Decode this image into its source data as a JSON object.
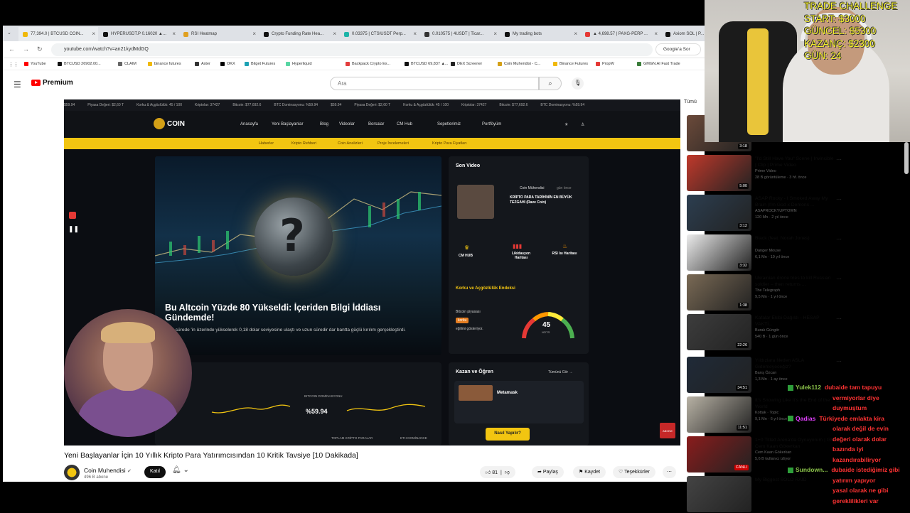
{
  "browser": {
    "tabs": [
      {
        "label": "77,394.0 | BTCUSD COIN..."
      },
      {
        "label": "HYPERUSDT.P 0.16020 ▲..."
      },
      {
        "label": "RSI Heatmap"
      },
      {
        "label": "Crypto Funding Rate Hea..."
      },
      {
        "label": "0.03375 | CTSIUSDT Perp..."
      },
      {
        "label": "0.010575 | 4USDT | Ticar..."
      },
      {
        "label": "My trading bots"
      },
      {
        "label": "▲ 4,698.57 | PAXG-PERP ..."
      },
      {
        "label": "Axiom SOL | P..."
      }
    ],
    "url": "youtube.com/watch?v=an21kydMdGQ",
    "google_label": "Google'a Sor",
    "bookmarks": [
      {
        "label": "YouTube",
        "color": "#ff0000"
      },
      {
        "label": "BTCUSD 26902.00...",
        "color": "#111111"
      },
      {
        "label": "CLAIM",
        "color": "#666666"
      },
      {
        "label": "binance futures",
        "color": "#f0b90b"
      },
      {
        "label": "Aster",
        "color": "#333333"
      },
      {
        "label": "OKX",
        "color": "#000000"
      },
      {
        "label": "Bitget Futures",
        "color": "#1da2b4"
      },
      {
        "label": "Hyperliquid",
        "color": "#59d6a4"
      },
      {
        "label": "Backpack Crypto Ex...",
        "color": "#e33d3d"
      },
      {
        "label": "BTCUSD 69,837 ▲...",
        "color": "#111111"
      },
      {
        "label": "DEX Screener",
        "color": "#222222"
      },
      {
        "label": "Coin Muhendisi - C...",
        "color": "#d4a017"
      },
      {
        "label": "Binance Futures",
        "color": "#f0b90b"
      },
      {
        "label": "PropW",
        "color": "#e53935"
      },
      {
        "label": "GMGN.AI Fast Trade",
        "color": "#3a7d3a"
      }
    ]
  },
  "youtube": {
    "logo_text": "Premium",
    "search_placeholder": "Ara",
    "video": {
      "title": "Yeni Başlayanlar İçin 10 Yıllık Kripto Para Yatırımcısından 10 Kritik Tavsiye [10 Dakikada]",
      "channel": "Coin Muhendisi",
      "subscribers": "496 B abone",
      "join_label": "Katıl",
      "likes": "81",
      "share_label": "Paylaş",
      "save_label": "Kaydet",
      "thanks_label": "Teşekkürler"
    },
    "sidebar_tab": "Tümü",
    "recommendations": [
      {
        "title": "",
        "channel": "",
        "meta": "1,1 Mn · 14 yıl önce",
        "duration": "3:18",
        "color": "#6b4a3a"
      },
      {
        "title": "\"I'd Still Have You\" Scene | Invincible | Clip | Prime Video",
        "channel": "Prime Video",
        "meta": "28 B görüntüleme · 3 hf. önce",
        "duration": "5:00",
        "color": "#c0392b"
      },
      {
        "title": "ASAP Rocky - I Smoked Away My Brain (I'm God x Demons ...",
        "channel": "ASAPROCKYUPTOWN",
        "meta": "120 Mn · 2 yıl önce",
        "duration": "3:12",
        "color": "#2c3e50"
      },
      {
        "title": "Black (feat. Norah Jones)",
        "channel": "Danger Mouse",
        "meta": "6,1 Mn · 10 yıl önce",
        "duration": "3:32",
        "color": "#ececec"
      },
      {
        "title": "Ukrainian drone tries to kill Russian soldier – then returns ...",
        "channel": "The Telegraph",
        "meta": "9,5 Mn · 1 yıl önce",
        "duration": "1:38",
        "color": "#7a6a55"
      },
      {
        "title": "Kafalar Ekibi Dağıldı - HESAP VAKTİ...",
        "channel": "Burak Güngör",
        "meta": "540 B · 1 gün önce",
        "duration": "22:26",
        "color": "#3d3d3d"
      },
      {
        "title": "Yıldızlara Neden ASLA Gidemeyeceğiz?",
        "channel": "Barış Özcan",
        "meta": "1,3 Mn · 1 ay önce",
        "duration": "34:51",
        "color": "#1f2a38"
      },
      {
        "title": "It's Snowing Like It's the End of the World",
        "channel": "Kottak · Topic",
        "meta": "9,1 Mn · 6 yıl önce",
        "duration": "11:51",
        "color": "#b8b2a5"
      },
      {
        "title": "1+0 Titled Arena'da Oynuyorum | GM Cem Kaan Gökerkan",
        "channel": "Cem Kaan Gökerkan",
        "meta": "5,6 B kullanıcı izliyor",
        "duration": "CANLI",
        "color": "#8a1c1c"
      },
      {
        "title": "My Biggest SOLO RAID",
        "channel": "",
        "meta": "",
        "duration": "",
        "color": "#444444"
      }
    ]
  },
  "embedded_site": {
    "brand": "COIN",
    "nav": [
      "Anasayfa",
      "Yeni Başlayanlar",
      "Blog",
      "Videolar",
      "Borsalar",
      "CM Hub",
      "Sepetlerimiz",
      "Portföyüm"
    ],
    "subnav": [
      "Haberler",
      "Kripto Rehberi",
      "Coin Analizleri",
      "Proje İncelemeleri",
      "Kripto Para Fiyatları"
    ],
    "ticker": [
      "$59.94",
      "Piyasa Değeri: $2,60 T",
      "Korku & Açgözlülük: 45 / 100",
      "Kriptolar: 37427",
      "Bitcoin: $77,692.6",
      "BTC Dominasyonu: %59.94"
    ],
    "headline": "Bu Altcoin Yüzde 80 Yükseldi: İçeriden Bilgi İddiası Gündemde!",
    "headline_desc": "Kısa sürede 'in üzerinde yükselerek 0,18 dolar seviyesine ulaştı ve uzun süredir dar bantta güçlü kırılım gerçekleştirdi.",
    "last_video_label": "Son Video",
    "last_video_title": "KRİPTO PARA TARİHİNİN EN BÜYÜK TEZGAHI (Rave Coin)",
    "last_video_channel": "Coin Mühendisi",
    "last_video_time": "gün önce",
    "tools": [
      "CM HUB",
      "Likidasyon Haritası",
      "RSI Isı Haritası"
    ],
    "fear_label": "Korku ve Açgözlülük Endeksi",
    "fear_desc": "Bitcoin piyasası",
    "fear_state": "korku",
    "fear_desc2": "eğilimi gösteriyor.",
    "fear_value": "45",
    "fear_word": "NÖTR",
    "earn_label": "Kazan ve Öğren",
    "earn_all": "Tümünü Gör →",
    "earn_item": "Metamask",
    "earn_btn": "Nasıl Yapılır?",
    "btc_dominance": "%59.94",
    "btc_dominance_label": "BITCOIN DOMİNASYONU",
    "total_label": "TOPLAM KRİPTO PARALAR",
    "eth_label": "ETH DOMİNANCE"
  },
  "stream_overlay": {
    "challenge_lines": [
      "TRADE CHALLENGE",
      "START: $3000",
      "GÜNCEL: $5300",
      "KAZANÇ: $2300",
      "GÜN: 24"
    ],
    "chat": [
      {
        "user": "Yulek112",
        "user_color": "#8bc34a",
        "text": "dubaide tam tapuyu",
        "color": "#ff3333"
      },
      {
        "user": "",
        "user_color": "",
        "text": "vermiyorlar diye",
        "color": "#ff3333"
      },
      {
        "user": "",
        "user_color": "",
        "text": "duymuştum",
        "color": "#ff3333"
      },
      {
        "user": "Qadias",
        "user_color": "#e040fb",
        "text": "Türkiyede emlakta kira",
        "color": "#ff3333"
      },
      {
        "user": "",
        "user_color": "",
        "text": "olarak değil de evin",
        "color": "#ff3333"
      },
      {
        "user": "",
        "user_color": "",
        "text": "değeri olarak dolar",
        "color": "#ff3333"
      },
      {
        "user": "",
        "user_color": "",
        "text": "bazında iyi",
        "color": "#ff3333"
      },
      {
        "user": "",
        "user_color": "",
        "text": "kazandırabiliryor",
        "color": "#ff3333"
      },
      {
        "user": "Sundown...",
        "user_color": "#8bc34a",
        "text": "dubaide istediğimiz gibi",
        "color": "#ff3333"
      },
      {
        "user": "",
        "user_color": "",
        "text": "yatırım yapıyor",
        "color": "#ff3333"
      },
      {
        "user": "",
        "user_color": "",
        "text": "yasal olarak ne gibi",
        "color": "#ff3333"
      },
      {
        "user": "",
        "user_color": "",
        "text": "gereklilikleri var",
        "color": "#ff3333"
      }
    ]
  }
}
